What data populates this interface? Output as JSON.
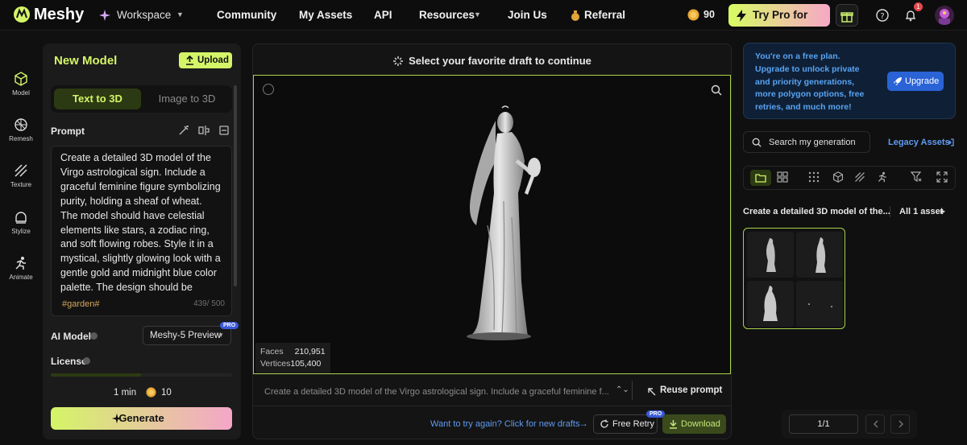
{
  "app": {
    "name": "Meshy"
  },
  "nav": {
    "workspace": "Workspace",
    "community": "Community",
    "my_assets": "My Assets",
    "api": "API",
    "resources": "Resources",
    "join_us": "Join Us",
    "referral": "Referral",
    "credits": "90",
    "try_pro": "Try Pro for Free",
    "notifications_count": "1"
  },
  "rail": [
    {
      "label": "Model",
      "icon": "cube-icon",
      "active": true
    },
    {
      "label": "Remesh",
      "icon": "remesh-icon"
    },
    {
      "label": "Texture",
      "icon": "texture-icon"
    },
    {
      "label": "Stylize",
      "icon": "stylize-icon"
    },
    {
      "label": "Animate",
      "icon": "animate-icon"
    }
  ],
  "left_panel": {
    "title": "New Model",
    "upload": "Upload",
    "tab_text": "Text to 3D",
    "tab_image": "Image to 3D",
    "prompt_label": "Prompt",
    "prompt_text": "Create a detailed 3D model of the Virgo astrological sign. Include a graceful feminine figure symbolizing purity, holding a sheaf of wheat. The model should have celestial elements like stars, a zodiac ring, and soft flowing robes. Style it in a mystical, slightly glowing look with a gentle gold and midnight blue color palette. The design should be elegant and",
    "hashtag": "#garden#",
    "char_count": "439/ 500",
    "ai_model_label": "AI Model",
    "ai_model_value": "Meshy-5 Preview",
    "pro_badge": "PRO",
    "license_label": "License",
    "time": "1 min",
    "cost": "10",
    "generate": "Generate"
  },
  "center": {
    "hint": "Select your favorite draft to continue",
    "faces_label": "Faces",
    "faces_value": "210,951",
    "vertices_label": "Vertices",
    "vertices_value": "105,400",
    "prompt_preview": "Create a detailed 3D model of the Virgo astrological sign. Include a graceful feminine f...",
    "reuse": "Reuse prompt",
    "try_again": "Want to try again? Click for new drafts",
    "free_retry": "Free Retry",
    "retry_badge": "PRO",
    "download": "Download"
  },
  "right_panel": {
    "banner_text": "You're on a free plan. Upgrade to unlock private and priority generations, more polygon options, free retries, and much more!",
    "upgrade": "Upgrade",
    "search_placeholder": "Search my generation",
    "legacy": "Legacy Assets",
    "generation_title": "Create a detailed 3D model of the...",
    "asset_count": "All 1 asset",
    "page": "1/1"
  },
  "colors": {
    "accent": "#d4f567",
    "link": "#5f9bf0",
    "viewer_border": "#a9d24a"
  }
}
